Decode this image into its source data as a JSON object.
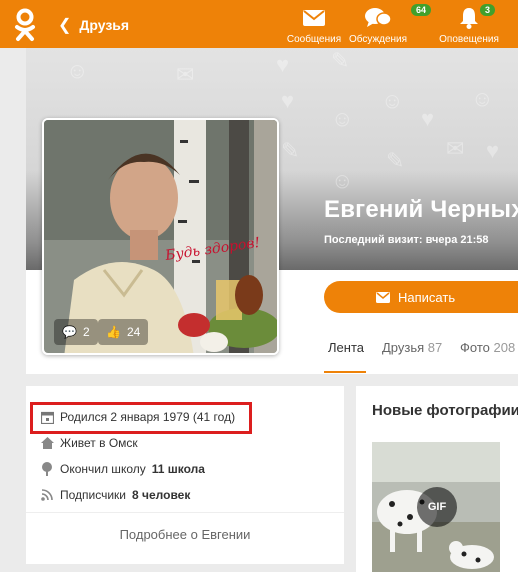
{
  "topbar": {
    "back_label": "Друзья",
    "nav": [
      {
        "label": "Сообщения",
        "icon": "envelope-icon"
      },
      {
        "label": "Обсуждения",
        "icon": "chat-bubbles-icon",
        "badge": "64"
      },
      {
        "label": "Оповещения",
        "icon": "bell-icon",
        "badge": "3"
      }
    ]
  },
  "profile": {
    "name": "Евгений Черных",
    "last_visit": "Последний визит: вчера 21:58",
    "write_button": "Написать",
    "photo_caption": "Будь здоров!",
    "avatar_comments": "2",
    "avatar_likes": "24"
  },
  "tabs": [
    {
      "label": "Лента",
      "count": ""
    },
    {
      "label": "Друзья",
      "count": "87"
    },
    {
      "label": "Фото",
      "count": "208"
    }
  ],
  "info": {
    "born": "Родился 2 января 1979 (41 год)",
    "lives": "Живет в Омск",
    "school_prefix": "Окончил школу",
    "school": "11 школа",
    "subs_prefix": "Подписчики",
    "subs": "8 человек",
    "more": "Подробнее о Евгении"
  },
  "photos": {
    "title": "Новые фотографии",
    "gif_label": "GIF"
  },
  "colors": {
    "accent": "#ee8208",
    "badge": "#41a02c",
    "highlight": "#dc1e1e"
  }
}
